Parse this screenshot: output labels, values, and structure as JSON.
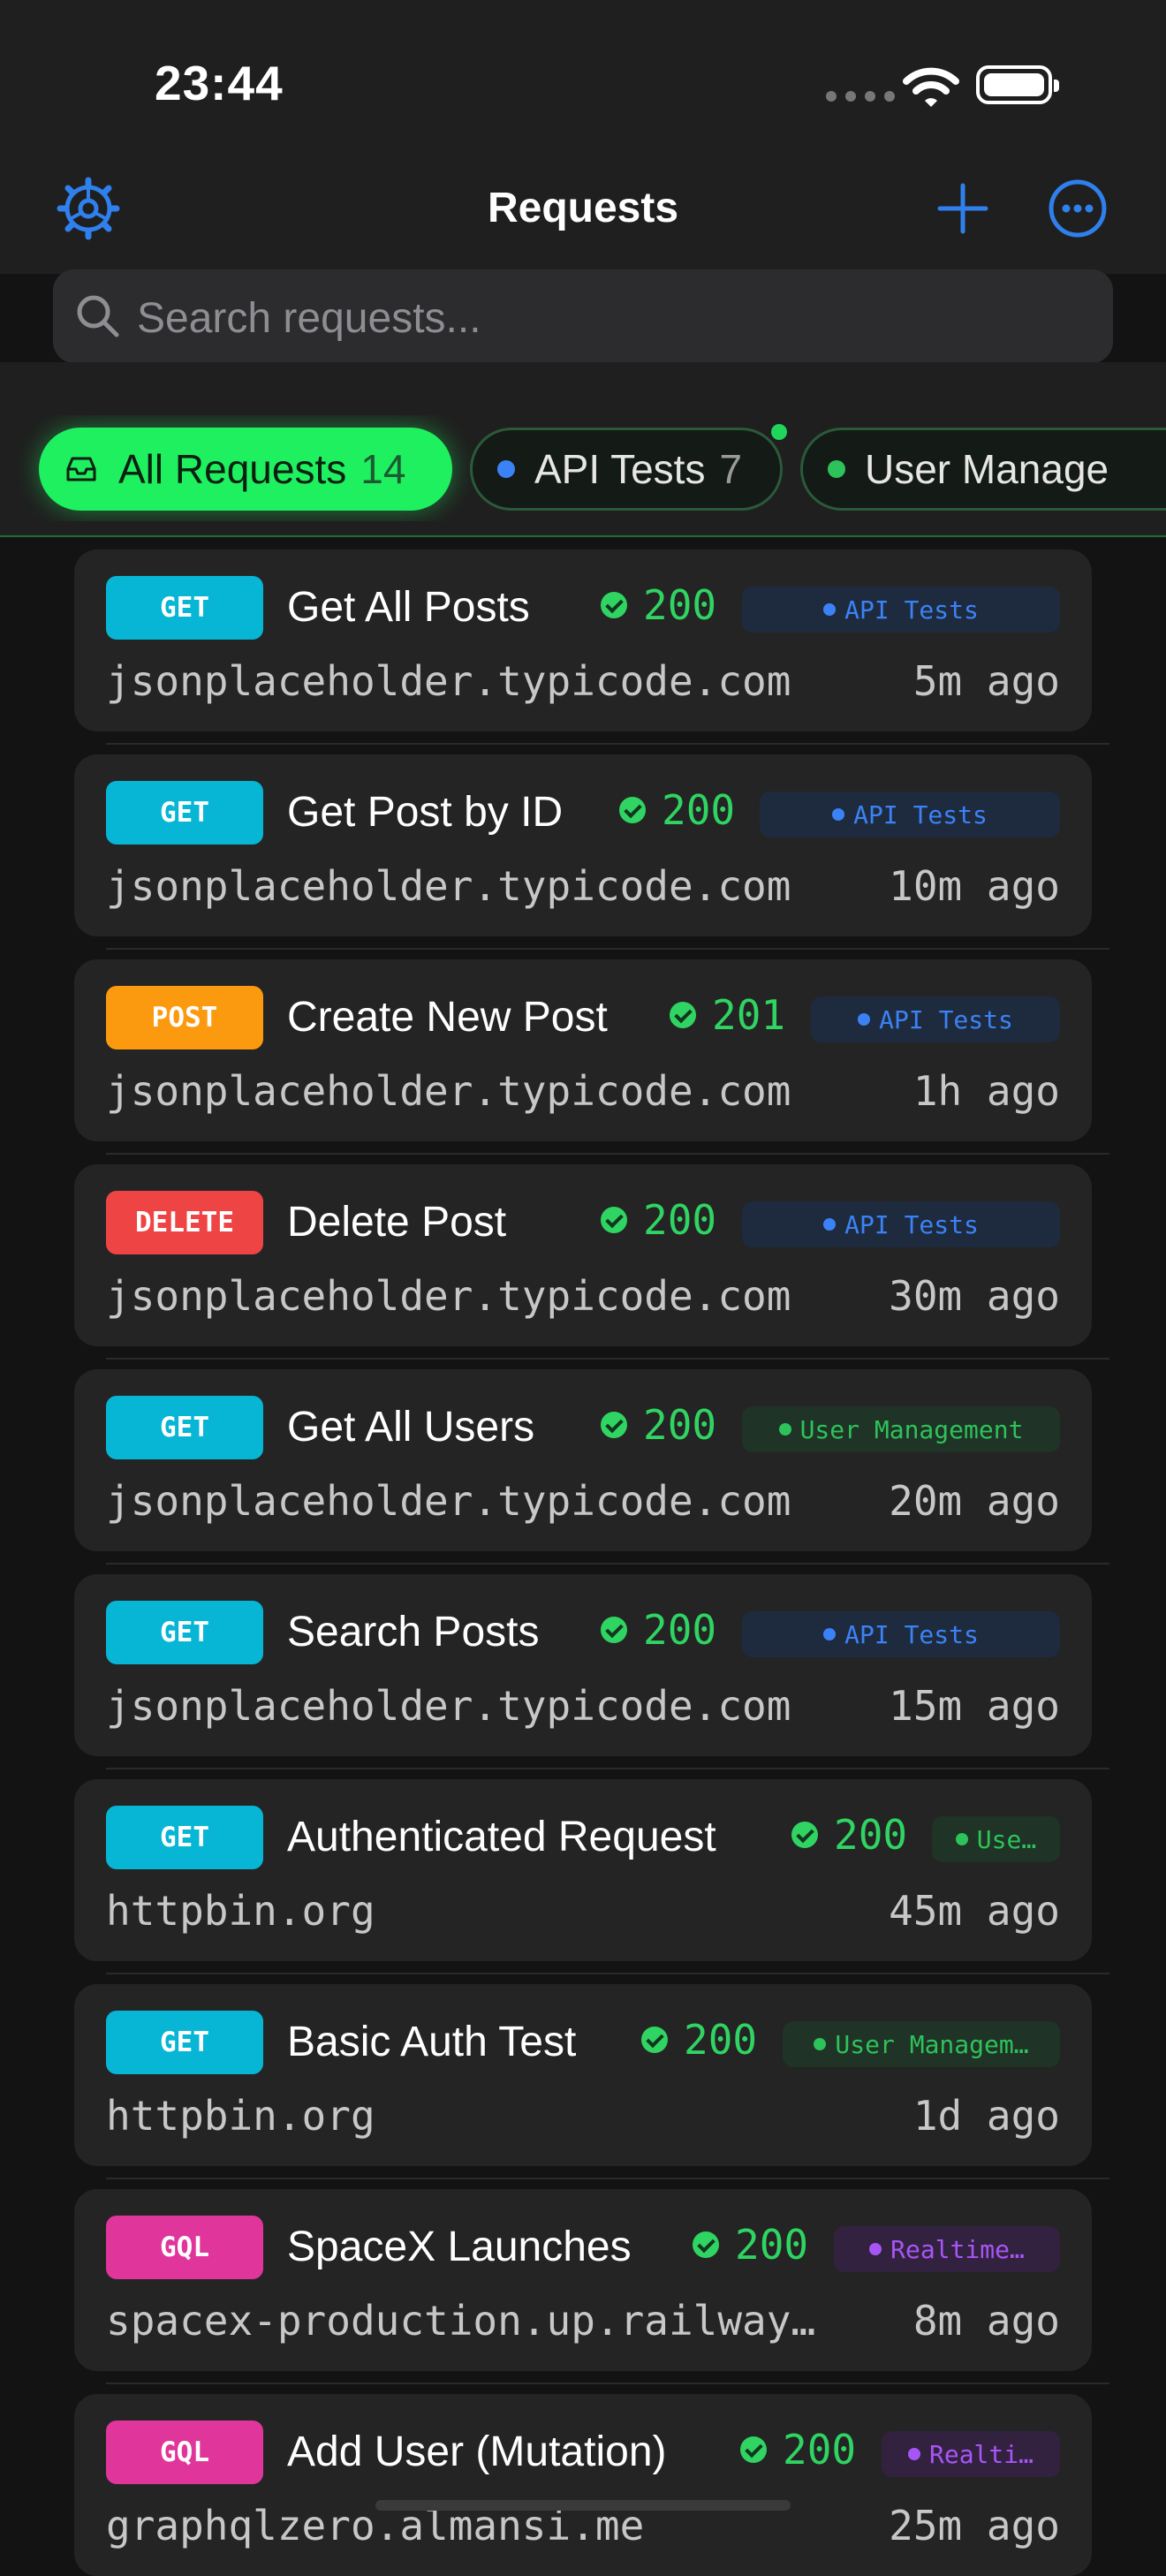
{
  "status_bar": {
    "time": "23:44"
  },
  "nav": {
    "title": "Requests"
  },
  "search": {
    "placeholder": "Search requests..."
  },
  "filters": [
    {
      "label": "All Requests",
      "count": "14",
      "active": true,
      "icon": "tray-icon"
    },
    {
      "label": "API Tests",
      "count": "7",
      "dot_color": "#3b82f6"
    },
    {
      "label": "User Manage",
      "count": "",
      "dot_color": "#2ec25a"
    }
  ],
  "requests": [
    {
      "method": "GET",
      "name": "Get All Posts",
      "status": "200",
      "tag": "API Tests",
      "host": "jsonplaceholder.typicode.com",
      "ago": "5m ago"
    },
    {
      "method": "GET",
      "name": "Get Post by ID",
      "status": "200",
      "tag": "API Tests",
      "host": "jsonplaceholder.typicode.com",
      "ago": "10m ago"
    },
    {
      "method": "POST",
      "name": "Create New Post",
      "status": "201",
      "tag": "API Tests",
      "host": "jsonplaceholder.typicode.com",
      "ago": "1h ago"
    },
    {
      "method": "DELETE",
      "name": "Delete Post",
      "status": "200",
      "tag": "API Tests",
      "host": "jsonplaceholder.typicode.com",
      "ago": "30m ago"
    },
    {
      "method": "GET",
      "name": "Get All Users",
      "status": "200",
      "tag": "User Management",
      "host": "jsonplaceholder.typicode.com",
      "ago": "20m ago"
    },
    {
      "method": "GET",
      "name": "Search Posts",
      "status": "200",
      "tag": "API Tests",
      "host": "jsonplaceholder.typicode.com",
      "ago": "15m ago"
    },
    {
      "method": "GET",
      "name": "Authenticated Request",
      "status": "200",
      "tag": "Use…",
      "host": "httpbin.org",
      "ago": "45m ago"
    },
    {
      "method": "GET",
      "name": "Basic Auth Test",
      "status": "200",
      "tag": "User Managem…",
      "host": "httpbin.org",
      "ago": "1d ago"
    },
    {
      "method": "GQL",
      "name": "SpaceX Launches",
      "status": "200",
      "tag": "Realtime…",
      "host": "spacex-production.up.railway…",
      "ago": "8m ago"
    },
    {
      "method": "GQL",
      "name": "Add User (Mutation)",
      "status": "200",
      "tag": "Realti…",
      "host": "graphqlzero.almansi.me",
      "ago": "25m ago"
    }
  ],
  "colors": {
    "accent": "#2f80ed",
    "active_filter": "#1ff060",
    "status_ok": "#2fd462",
    "get": "#06b6d4",
    "post": "#fb9a0f",
    "delete": "#ef4444",
    "gql": "#e0369b"
  }
}
